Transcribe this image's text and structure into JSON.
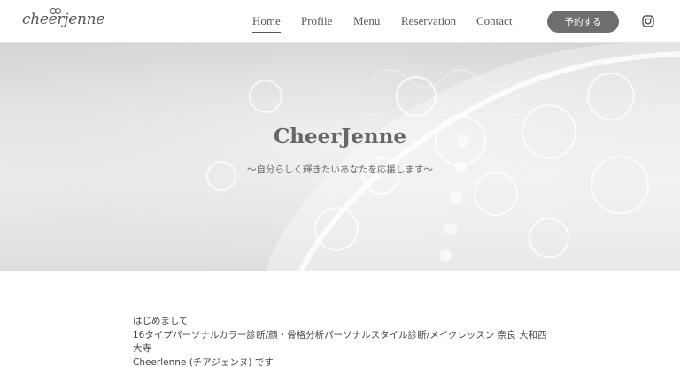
{
  "header": {
    "logo_text": "cheerjenne",
    "nav": [
      {
        "label": "Home",
        "active": true
      },
      {
        "label": "Profile",
        "active": false
      },
      {
        "label": "Menu",
        "active": false
      },
      {
        "label": "Reservation",
        "active": false
      },
      {
        "label": "Contact",
        "active": false
      }
    ],
    "reserve_label": "予約する",
    "instagram_icon": "instagram-icon"
  },
  "hero": {
    "title": "CheerJenne",
    "subtitle": "〜自分らしく輝きたいあなたを応援します〜"
  },
  "intro": {
    "lines": [
      "はじめまして",
      "16タイプパーソナルカラー診断/顔・骨格分析パーソナルスタイル診断/メイクレッスン 奈良 大和西大寺",
      "Cheerlenne (チアジェンヌ) です"
    ]
  },
  "colors": {
    "button_bg": "#6e6e6e",
    "text": "#555555"
  }
}
